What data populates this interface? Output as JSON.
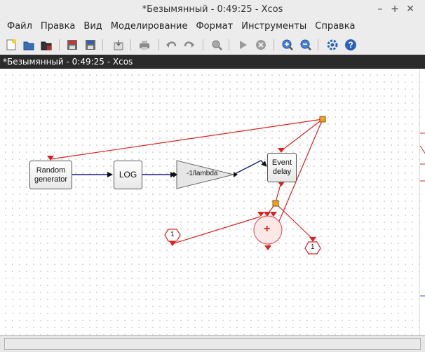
{
  "window": {
    "title": "*Безымянный - 0:49:25 - Xcos",
    "minimize": "–",
    "maximize": "+",
    "close": "✕"
  },
  "menu": [
    "Файл",
    "Правка",
    "Вид",
    "Моделирование",
    "Формат",
    "Инструменты",
    "Справка"
  ],
  "toolbar_icons": [
    "new-diagram-icon",
    "open-icon",
    "open-in-scilab-icon",
    "save-icon",
    "save-as-icon",
    "export-icon",
    "print-icon",
    "undo-icon",
    "redo-icon",
    "fit-diagram-icon",
    "start-icon",
    "stop-icon",
    "zoom-in-icon",
    "zoom-out-icon",
    "setup-icon",
    "help-icon"
  ],
  "tab": {
    "title": "*Безымянный - 0:49:25 - Xcos"
  },
  "blocks": {
    "random": {
      "line1": "Random",
      "line2": "generator"
    },
    "log": {
      "label": "LOG"
    },
    "gain": {
      "label": "-1/lambda"
    },
    "event_delay": {
      "line1": "Event",
      "line2": "delay"
    },
    "sum": {
      "symbol": "+"
    },
    "input_port": {
      "label": "1"
    },
    "output_port": {
      "label": "1"
    }
  },
  "colors": {
    "data_link": "#1a1a8c",
    "event_link": "#e02020",
    "split": "#f0a020",
    "accent": "#2255cc"
  }
}
